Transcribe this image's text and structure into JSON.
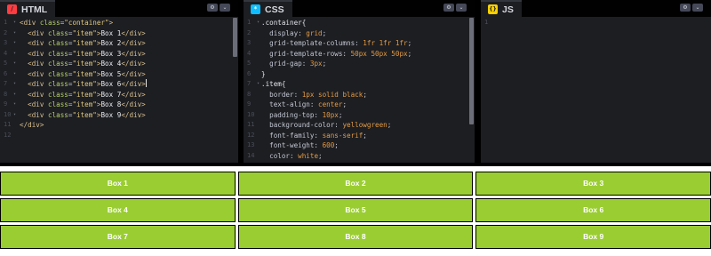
{
  "panels": {
    "html": {
      "title": "HTML",
      "icon": "html-icon",
      "icon_glyph": "/",
      "icon_color": "#ff3c41",
      "line_numbers": [
        "1",
        "2",
        "3",
        "4",
        "5",
        "6",
        "7",
        "8",
        "9",
        "10",
        "11",
        "12"
      ],
      "lines": [
        [
          [
            "t",
            "<div "
          ],
          [
            "a",
            "class"
          ],
          [
            "p",
            "="
          ],
          [
            "s",
            "\"container\""
          ],
          [
            "t",
            ">"
          ]
        ],
        [
          [
            "p",
            "  "
          ],
          [
            "t",
            "<div "
          ],
          [
            "a",
            "class"
          ],
          [
            "p",
            "="
          ],
          [
            "s",
            "\"item\""
          ],
          [
            "t",
            ">"
          ],
          [
            "tx",
            "Box 1"
          ],
          [
            "t",
            "</div>"
          ]
        ],
        [
          [
            "p",
            "  "
          ],
          [
            "t",
            "<div "
          ],
          [
            "a",
            "class"
          ],
          [
            "p",
            "="
          ],
          [
            "s",
            "\"item\""
          ],
          [
            "t",
            ">"
          ],
          [
            "tx",
            "Box 2"
          ],
          [
            "t",
            "</div>"
          ]
        ],
        [
          [
            "p",
            "  "
          ],
          [
            "t",
            "<div "
          ],
          [
            "a",
            "class"
          ],
          [
            "p",
            "="
          ],
          [
            "s",
            "\"item\""
          ],
          [
            "t",
            ">"
          ],
          [
            "tx",
            "Box 3"
          ],
          [
            "t",
            "</div>"
          ]
        ],
        [
          [
            "p",
            "  "
          ],
          [
            "t",
            "<div "
          ],
          [
            "a",
            "class"
          ],
          [
            "p",
            "="
          ],
          [
            "s",
            "\"item\""
          ],
          [
            "t",
            ">"
          ],
          [
            "tx",
            "Box 4"
          ],
          [
            "t",
            "</div>"
          ]
        ],
        [
          [
            "p",
            "  "
          ],
          [
            "t",
            "<div "
          ],
          [
            "a",
            "class"
          ],
          [
            "p",
            "="
          ],
          [
            "s",
            "\"item\""
          ],
          [
            "t",
            ">"
          ],
          [
            "tx",
            "Box 5"
          ],
          [
            "t",
            "</div>"
          ]
        ],
        [
          [
            "p",
            "  "
          ],
          [
            "t",
            "<div "
          ],
          [
            "a",
            "class"
          ],
          [
            "p",
            "="
          ],
          [
            "s",
            "\"item\""
          ],
          [
            "t",
            ">"
          ],
          [
            "tx",
            "Box 6"
          ],
          [
            "t",
            "</div>"
          ],
          [
            "cursor",
            ""
          ]
        ],
        [
          [
            "p",
            "  "
          ],
          [
            "t",
            "<div "
          ],
          [
            "a",
            "class"
          ],
          [
            "p",
            "="
          ],
          [
            "s",
            "\"item\""
          ],
          [
            "t",
            ">"
          ],
          [
            "tx",
            "Box 7"
          ],
          [
            "t",
            "</div>"
          ]
        ],
        [
          [
            "p",
            "  "
          ],
          [
            "t",
            "<div "
          ],
          [
            "a",
            "class"
          ],
          [
            "p",
            "="
          ],
          [
            "s",
            "\"item\""
          ],
          [
            "t",
            ">"
          ],
          [
            "tx",
            "Box 8"
          ],
          [
            "t",
            "</div>"
          ]
        ],
        [
          [
            "p",
            "  "
          ],
          [
            "t",
            "<div "
          ],
          [
            "a",
            "class"
          ],
          [
            "p",
            "="
          ],
          [
            "s",
            "\"item\""
          ],
          [
            "t",
            ">"
          ],
          [
            "tx",
            "Box 9"
          ],
          [
            "t",
            "</div>"
          ]
        ],
        [
          [
            "t",
            "</div>"
          ]
        ],
        [
          [
            "p",
            ""
          ]
        ]
      ]
    },
    "css": {
      "title": "CSS",
      "icon": "css-icon",
      "icon_glyph": "*",
      "icon_color": "#0ebeff",
      "line_numbers": [
        "1",
        "2",
        "3",
        "4",
        "5",
        "6",
        "7",
        "8",
        "9",
        "10",
        "11",
        "12",
        "13",
        "14"
      ],
      "lines": [
        [
          [
            "sel",
            ".container{"
          ]
        ],
        [
          [
            "p",
            "  display: "
          ],
          [
            "kv",
            "grid"
          ],
          [
            "p",
            ";"
          ]
        ],
        [
          [
            "p",
            "  grid-template-columns: "
          ],
          [
            "num",
            "1fr 1fr 1fr"
          ],
          [
            "p",
            ";"
          ]
        ],
        [
          [
            "p",
            "  grid-template-rows: "
          ],
          [
            "num",
            "50px 50px 50px"
          ],
          [
            "p",
            ";"
          ]
        ],
        [
          [
            "p",
            "  grid-gap: "
          ],
          [
            "num",
            "3px"
          ],
          [
            "p",
            ";"
          ]
        ],
        [
          [
            "sel",
            "}"
          ]
        ],
        [
          [
            "sel",
            ".item{"
          ]
        ],
        [
          [
            "p",
            "  border: "
          ],
          [
            "num",
            "1px"
          ],
          [
            "kv",
            " solid black"
          ],
          [
            "p",
            ";"
          ]
        ],
        [
          [
            "p",
            "  text-align: "
          ],
          [
            "kv",
            "center"
          ],
          [
            "p",
            ";"
          ]
        ],
        [
          [
            "p",
            "  padding-top: "
          ],
          [
            "num",
            "10px"
          ],
          [
            "p",
            ";"
          ]
        ],
        [
          [
            "p",
            "  background-color: "
          ],
          [
            "kv",
            "yellowgreen"
          ],
          [
            "p",
            ";"
          ]
        ],
        [
          [
            "p",
            "  font-family: "
          ],
          [
            "kv",
            "sans-serif"
          ],
          [
            "p",
            ";"
          ]
        ],
        [
          [
            "p",
            "  font-weight: "
          ],
          [
            "num",
            "600"
          ],
          [
            "p",
            ";"
          ]
        ],
        [
          [
            "p",
            "  color: "
          ],
          [
            "kv",
            "white"
          ],
          [
            "p",
            ";"
          ]
        ]
      ]
    },
    "js": {
      "title": "JS",
      "icon": "js-icon",
      "icon_glyph": "{}",
      "icon_color": "#fcd000",
      "line_numbers": [
        "1"
      ],
      "lines": []
    },
    "settings_glyph": "⚙",
    "expand_glyph": "⌄"
  },
  "preview": {
    "items": [
      "Box 1",
      "Box 2",
      "Box 3",
      "Box 4",
      "Box 5",
      "Box 6",
      "Box 7",
      "Box 8",
      "Box 9"
    ]
  }
}
